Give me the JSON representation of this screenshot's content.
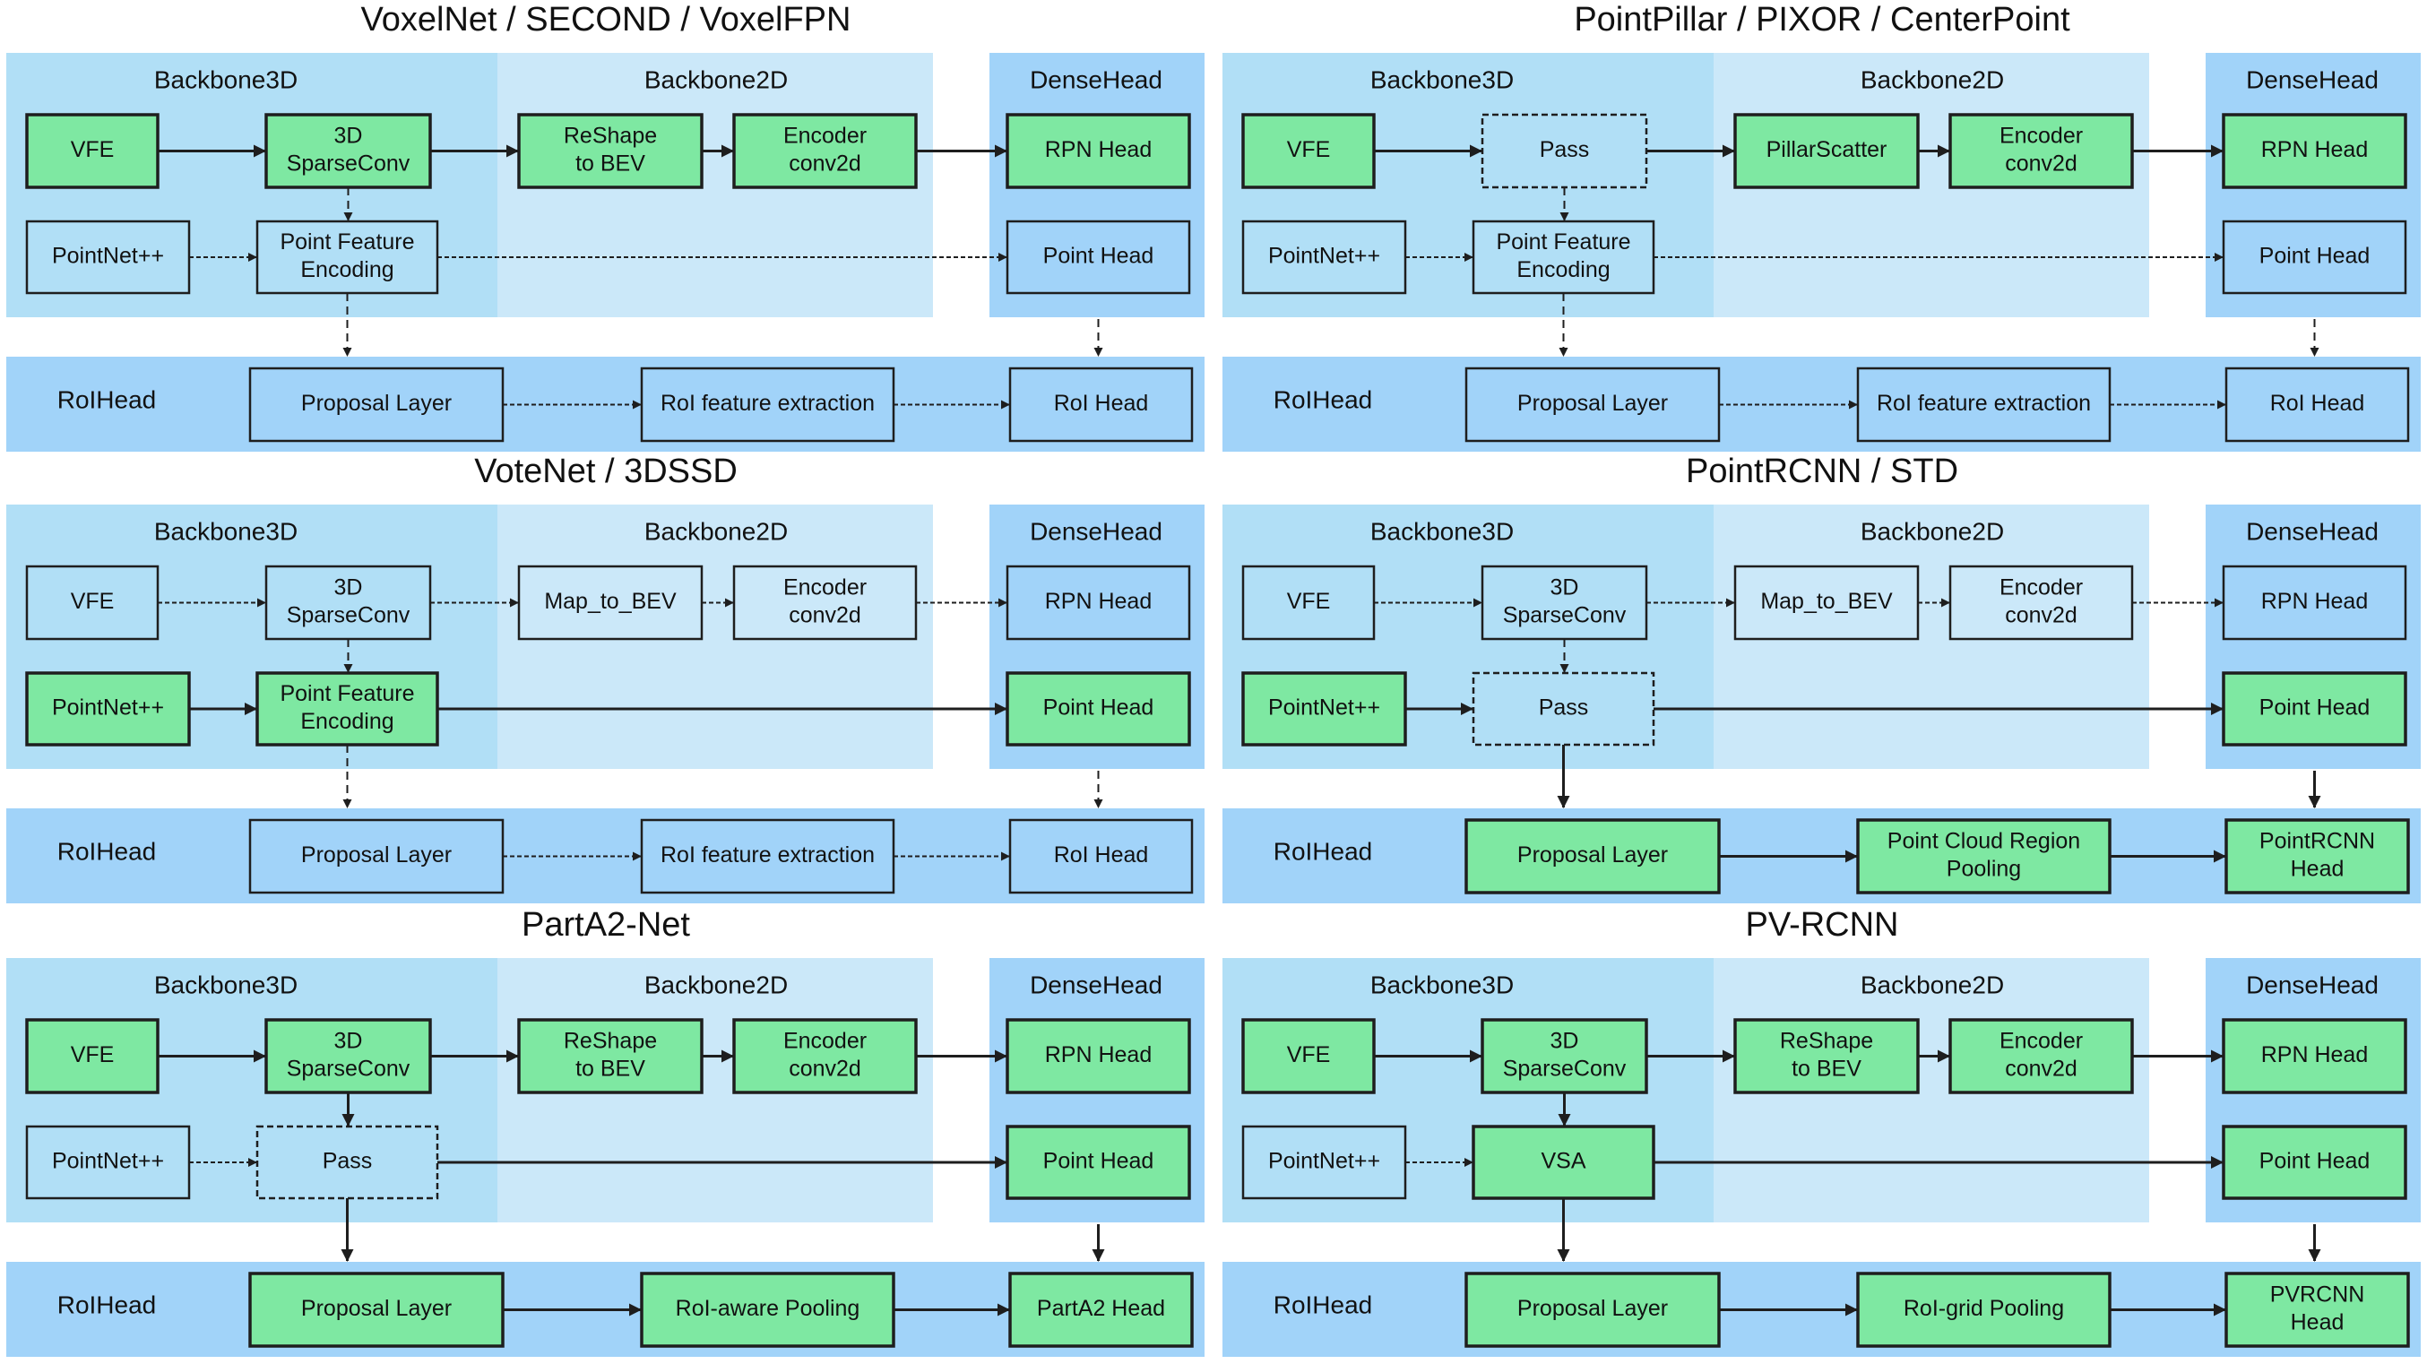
{
  "colors": {
    "backbone3d": "#b1dff6",
    "backbone2d": "#cbe8f9",
    "densehead": "#a1d3f9",
    "roihead": "#a1d3f9",
    "active_box": "#7ee8a2",
    "stroke": "#1e1e1e"
  },
  "section_labels": {
    "backbone3d": "Backbone3D",
    "backbone2d": "Backbone2D",
    "densehead": "DenseHead",
    "roihead": "RoIHead"
  },
  "panels": [
    {
      "id": "voxelnet",
      "title": "VoxelNet / SECOND / VoxelFPN",
      "boxes": {
        "b3a": {
          "label": [
            "VFE"
          ],
          "active": true
        },
        "b3b": {
          "label": [
            "3D",
            "SparseConv"
          ],
          "active": true
        },
        "b2a": {
          "label": [
            "ReShape",
            "to BEV"
          ],
          "active": true
        },
        "b2b": {
          "label": [
            "Encoder",
            "conv2d"
          ],
          "active": true
        },
        "dh1": {
          "label": [
            "RPN Head"
          ],
          "active": true
        },
        "p1": {
          "label": [
            "PointNet++"
          ],
          "active": false
        },
        "p2": {
          "label": [
            "Point Feature",
            "Encoding"
          ],
          "active": false
        },
        "dh2": {
          "label": [
            "Point Head"
          ],
          "active": false
        },
        "r1": {
          "label": [
            "Proposal Layer"
          ],
          "active": false
        },
        "r2": {
          "label": [
            "RoI feature extraction"
          ],
          "active": false
        },
        "r3": {
          "label": [
            "RoI Head"
          ],
          "active": false
        }
      },
      "edges": {
        "b3a-b3b": "solid",
        "b3b-b2a": "solid",
        "b2a-b2b": "solid",
        "b2b-dh1": "solid",
        "p1-p2": "dotted",
        "p2-dh2": "dotted",
        "b3b-p2": "dashed",
        "p2-r1": "dashed",
        "dh-r3": "dashed",
        "r1-r2": "dotted",
        "r2-r3": "dotted"
      }
    },
    {
      "id": "pointpillar",
      "title": "PointPillar / PIXOR / CenterPoint",
      "boxes": {
        "b3a": {
          "label": [
            "VFE"
          ],
          "active": true
        },
        "b3b": {
          "label": [
            "Pass"
          ],
          "active": false,
          "dashed": true
        },
        "b2a": {
          "label": [
            "PillarScatter"
          ],
          "active": true
        },
        "b2b": {
          "label": [
            "Encoder",
            "conv2d"
          ],
          "active": true
        },
        "dh1": {
          "label": [
            "RPN Head"
          ],
          "active": true
        },
        "p1": {
          "label": [
            "PointNet++"
          ],
          "active": false
        },
        "p2": {
          "label": [
            "Point Feature",
            "Encoding"
          ],
          "active": false
        },
        "dh2": {
          "label": [
            "Point Head"
          ],
          "active": false
        },
        "r1": {
          "label": [
            "Proposal Layer"
          ],
          "active": false
        },
        "r2": {
          "label": [
            "RoI feature extraction"
          ],
          "active": false
        },
        "r3": {
          "label": [
            "RoI Head"
          ],
          "active": false
        }
      },
      "edges": {
        "b3a-b3b": "solid",
        "b3b-b2a": "solid",
        "b2a-b2b": "solid",
        "b2b-dh1": "solid",
        "p1-p2": "dotted",
        "p2-dh2": "dotted",
        "b3b-p2": "dashed",
        "p2-r1": "dashed",
        "dh-r3": "dashed",
        "r1-r2": "dotted",
        "r2-r3": "dotted"
      }
    },
    {
      "id": "votenet",
      "title": "VoteNet / 3DSSD",
      "boxes": {
        "b3a": {
          "label": [
            "VFE"
          ],
          "active": false
        },
        "b3b": {
          "label": [
            "3D",
            "SparseConv"
          ],
          "active": false
        },
        "b2a": {
          "label": [
            "Map_to_BEV"
          ],
          "active": false
        },
        "b2b": {
          "label": [
            "Encoder",
            "conv2d"
          ],
          "active": false
        },
        "dh1": {
          "label": [
            "RPN Head"
          ],
          "active": false
        },
        "p1": {
          "label": [
            "PointNet++"
          ],
          "active": true
        },
        "p2": {
          "label": [
            "Point Feature",
            "Encoding"
          ],
          "active": true
        },
        "dh2": {
          "label": [
            "Point Head"
          ],
          "active": true
        },
        "r1": {
          "label": [
            "Proposal Layer"
          ],
          "active": false
        },
        "r2": {
          "label": [
            "RoI feature extraction"
          ],
          "active": false
        },
        "r3": {
          "label": [
            "RoI Head"
          ],
          "active": false
        }
      },
      "edges": {
        "b3a-b3b": "dotted",
        "b3b-b2a": "dotted",
        "b2a-b2b": "dotted",
        "b2b-dh1": "dotted",
        "p1-p2": "solid",
        "p2-dh2": "solid",
        "b3b-p2": "dashed",
        "p2-r1": "dashed",
        "dh-r3": "dashed",
        "r1-r2": "dotted",
        "r2-r3": "dotted"
      }
    },
    {
      "id": "pointrcnn",
      "title": "PointRCNN / STD",
      "boxes": {
        "b3a": {
          "label": [
            "VFE"
          ],
          "active": false
        },
        "b3b": {
          "label": [
            "3D",
            "SparseConv"
          ],
          "active": false
        },
        "b2a": {
          "label": [
            "Map_to_BEV"
          ],
          "active": false
        },
        "b2b": {
          "label": [
            "Encoder",
            "conv2d"
          ],
          "active": false
        },
        "dh1": {
          "label": [
            "RPN Head"
          ],
          "active": false
        },
        "p1": {
          "label": [
            "PointNet++"
          ],
          "active": true
        },
        "p2": {
          "label": [
            "Pass"
          ],
          "active": false,
          "dashed": true
        },
        "dh2": {
          "label": [
            "Point Head"
          ],
          "active": true
        },
        "r1": {
          "label": [
            "Proposal Layer"
          ],
          "active": true
        },
        "r2": {
          "label": [
            "Point Cloud Region",
            "Pooling"
          ],
          "active": true
        },
        "r3": {
          "label": [
            "PointRCNN",
            "Head"
          ],
          "active": true
        }
      },
      "edges": {
        "b3a-b3b": "dotted",
        "b3b-b2a": "dotted",
        "b2a-b2b": "dotted",
        "b2b-dh1": "dotted",
        "p1-p2": "solid",
        "p2-dh2": "solid",
        "b3b-p2": "dashed",
        "p2-r1": "solid",
        "dh-r3": "solid",
        "r1-r2": "solid",
        "r2-r3": "solid"
      }
    },
    {
      "id": "parta2",
      "title": "PartA2-Net",
      "boxes": {
        "b3a": {
          "label": [
            "VFE"
          ],
          "active": true
        },
        "b3b": {
          "label": [
            "3D",
            "SparseConv"
          ],
          "active": true
        },
        "b2a": {
          "label": [
            "ReShape",
            "to BEV"
          ],
          "active": true
        },
        "b2b": {
          "label": [
            "Encoder",
            "conv2d"
          ],
          "active": true
        },
        "dh1": {
          "label": [
            "RPN Head"
          ],
          "active": true
        },
        "p1": {
          "label": [
            "PointNet++"
          ],
          "active": false
        },
        "p2": {
          "label": [
            "Pass"
          ],
          "active": false,
          "dashed": true
        },
        "dh2": {
          "label": [
            "Point Head"
          ],
          "active": true
        },
        "r1": {
          "label": [
            "Proposal Layer"
          ],
          "active": true
        },
        "r2": {
          "label": [
            "RoI-aware Pooling"
          ],
          "active": true
        },
        "r3": {
          "label": [
            "PartA2 Head"
          ],
          "active": true
        }
      },
      "edges": {
        "b3a-b3b": "solid",
        "b3b-b2a": "solid",
        "b2a-b2b": "solid",
        "b2b-dh1": "solid",
        "p1-p2": "dotted",
        "p2-dh2": "solid",
        "b3b-p2": "solid",
        "p2-r1": "solid",
        "dh-r3": "solid",
        "r1-r2": "solid",
        "r2-r3": "solid"
      }
    },
    {
      "id": "pvrcnn",
      "title": "PV-RCNN",
      "boxes": {
        "b3a": {
          "label": [
            "VFE"
          ],
          "active": true
        },
        "b3b": {
          "label": [
            "3D",
            "SparseConv"
          ],
          "active": true
        },
        "b2a": {
          "label": [
            "ReShape",
            "to BEV"
          ],
          "active": true
        },
        "b2b": {
          "label": [
            "Encoder",
            "conv2d"
          ],
          "active": true
        },
        "dh1": {
          "label": [
            "RPN Head"
          ],
          "active": true
        },
        "p1": {
          "label": [
            "PointNet++"
          ],
          "active": false
        },
        "p2": {
          "label": [
            "VSA"
          ],
          "active": true
        },
        "dh2": {
          "label": [
            "Point Head"
          ],
          "active": true
        },
        "r1": {
          "label": [
            "Proposal Layer"
          ],
          "active": true
        },
        "r2": {
          "label": [
            "RoI-grid Pooling"
          ],
          "active": true
        },
        "r3": {
          "label": [
            "PVRCNN",
            "Head"
          ],
          "active": true
        }
      },
      "edges": {
        "b3a-b3b": "solid",
        "b3b-b2a": "solid",
        "b2a-b2b": "solid",
        "b2b-dh1": "solid",
        "p1-p2": "dotted",
        "p2-dh2": "solid",
        "b3b-p2": "solid",
        "p2-r1": "solid",
        "dh-r3": "solid",
        "r1-r2": "solid",
        "r2-r3": "solid"
      }
    }
  ]
}
